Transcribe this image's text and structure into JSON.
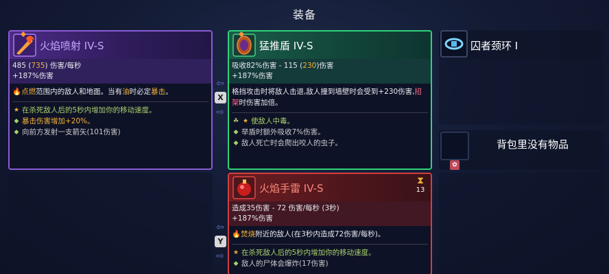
{
  "header": {
    "title": "装备"
  },
  "items": {
    "fire_breath": {
      "name": "火焰喷射 IV-S",
      "stats": {
        "dps_base": "485 (",
        "dps_value": "735",
        "dps_suffix": ") 伤害/每秒",
        "bonus": "+187%伤害"
      },
      "desc": {
        "p1": "点燃",
        "p2": "范围内的敌人和地面。当有",
        "p3": "油",
        "p4": "时必定",
        "p5": "暴击",
        "p6": "。"
      },
      "mods": [
        {
          "text": "在杀死敌人后的5秒内增加你的移动速度。",
          "color": "green"
        },
        {
          "text": "暴击伤害增加+20%。",
          "color": "orange"
        },
        {
          "text": "向前方发射一支箭矢(101伤害)",
          "color": "grey"
        }
      ]
    },
    "shield": {
      "name": "猛推盾 IV-S",
      "stats": {
        "block_pre": "吸收82%伤害 - 115 (",
        "block_value": "230",
        "block_suffix": ")伤害",
        "bonus": "+187%伤害"
      },
      "desc": {
        "p1": "格挡攻击时将敌人击退,敌人撞到墙壁时会受到+230伤害,",
        "p2": "招架",
        "p3": "时伤害加倍。"
      },
      "mods": [
        {
          "text": "使敌人中毒。",
          "color": "green"
        },
        {
          "text": "举盾时额外吸收7%伤害。",
          "color": "grey"
        },
        {
          "text": "敌人死亡时会爬出咬人的虫子。",
          "color": "grey"
        }
      ]
    },
    "grenade": {
      "name": "火焰手雷 IV-S",
      "cooldown": "13",
      "stats": {
        "line1": "造成35伤害 - 72 伤害/每秒 (3秒)",
        "bonus": "+187%伤害"
      },
      "desc": {
        "p1": "焚烧",
        "p2": "附近的敌人(在3秒内造成72伤害/每秒)。"
      },
      "mods": [
        {
          "text": "在杀死敌人后的5秒内增加你的移动速度。",
          "color": "green"
        },
        {
          "text": "敌人的尸体会爆炸(17伤害)",
          "color": "grey"
        }
      ]
    }
  },
  "keys": {
    "x": "X",
    "y": "Y"
  },
  "right": {
    "amulet": "囚者颈环 I",
    "backpack_empty": "背包里没有物品"
  },
  "colors": {
    "purple": "#8a5cd6",
    "green": "#2fd37a",
    "red": "#d24040",
    "orange": "#f3b03a"
  }
}
